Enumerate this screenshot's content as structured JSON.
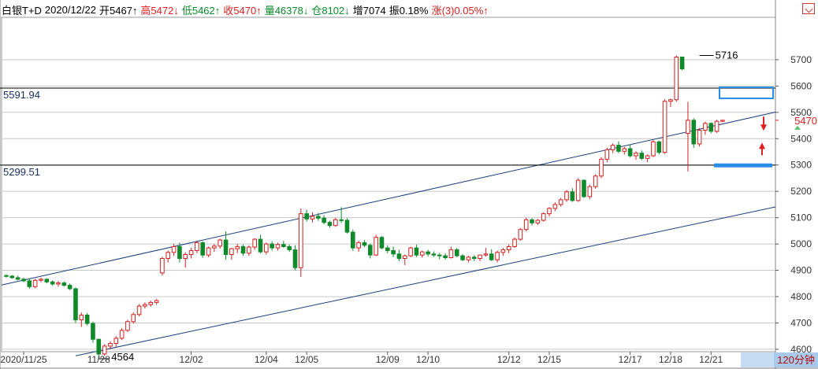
{
  "header": {
    "symbol": "白银T+D",
    "date": "2020/12/22",
    "open": "开5467↑",
    "high": "高5472↓",
    "low": "低5462↑",
    "close": "收5470↑",
    "volume": "量46378↓",
    "position": "仓8102↓",
    "increase": "增7074",
    "amplitude": "振0.18%",
    "change": "涨(3)0.05%↑"
  },
  "timeframe": "120分钟",
  "colors": {
    "up": "#d42020",
    "down": "#0e8a2a",
    "channel": "#1a3f7a",
    "highlight": "#2a8ee8",
    "grid": "#c8c8c8"
  },
  "chart_data": {
    "type": "candlestick",
    "ylim": [
      4575,
      5775
    ],
    "y_ticks": [
      4600,
      4700,
      4800,
      4900,
      5000,
      5100,
      5200,
      5300,
      5400,
      5500,
      5600,
      5700
    ],
    "x_labels": [
      {
        "label": "2020/11/25",
        "index": 3
      },
      {
        "label": "11/28",
        "index": 16
      },
      {
        "label": "12/02",
        "index": 32
      },
      {
        "label": "12/04",
        "index": 45
      },
      {
        "label": "12/05",
        "index": 52
      },
      {
        "label": "12/09",
        "index": 66
      },
      {
        "label": "12/10",
        "index": 73
      },
      {
        "label": "12/12",
        "index": 87
      },
      {
        "label": "12/15",
        "index": 94
      },
      {
        "label": "12/17",
        "index": 108
      },
      {
        "label": "12/18",
        "index": 115
      },
      {
        "label": "12/21",
        "index": 122
      }
    ],
    "candles": [
      [
        4880,
        4885,
        4872,
        4878
      ],
      [
        4878,
        4882,
        4868,
        4872
      ],
      [
        4872,
        4880,
        4862,
        4866
      ],
      [
        4866,
        4872,
        4855,
        4860
      ],
      [
        4860,
        4868,
        4830,
        4838
      ],
      [
        4838,
        4868,
        4832,
        4862
      ],
      [
        4862,
        4872,
        4855,
        4866
      ],
      [
        4866,
        4870,
        4850,
        4856
      ],
      [
        4856,
        4862,
        4842,
        4848
      ],
      [
        4848,
        4860,
        4838,
        4852
      ],
      [
        4852,
        4858,
        4838,
        4843
      ],
      [
        4843,
        4850,
        4825,
        4830
      ],
      [
        4830,
        4835,
        4700,
        4712
      ],
      [
        4712,
        4740,
        4685,
        4730
      ],
      [
        4730,
        4738,
        4690,
        4698
      ],
      [
        4698,
        4705,
        4625,
        4638
      ],
      [
        4638,
        4640,
        4564,
        4582
      ],
      [
        4582,
        4620,
        4575,
        4612
      ],
      [
        4612,
        4630,
        4600,
        4622
      ],
      [
        4622,
        4650,
        4610,
        4642
      ],
      [
        4642,
        4680,
        4635,
        4672
      ],
      [
        4672,
        4712,
        4665,
        4705
      ],
      [
        4705,
        4740,
        4698,
        4732
      ],
      [
        4732,
        4772,
        4725,
        4764
      ],
      [
        4764,
        4778,
        4755,
        4770
      ],
      [
        4770,
        4785,
        4762,
        4778
      ],
      [
        4778,
        4790,
        4770,
        4785
      ],
      [
        4890,
        4952,
        4880,
        4945
      ],
      [
        4945,
        4975,
        4930,
        4968
      ],
      [
        4968,
        5000,
        4955,
        4990
      ],
      [
        4990,
        5005,
        4930,
        4945
      ],
      [
        4945,
        4968,
        4910,
        4960
      ],
      [
        4960,
        4985,
        4945,
        4975
      ],
      [
        4975,
        5012,
        4965,
        5005
      ],
      [
        5005,
        5010,
        4948,
        4958
      ],
      [
        4958,
        4990,
        4950,
        4985
      ],
      [
        4985,
        5000,
        4970,
        4992
      ],
      [
        4992,
        5020,
        4982,
        5015
      ],
      [
        5015,
        5048,
        4940,
        4960
      ],
      [
        4960,
        4985,
        4940,
        4982
      ],
      [
        4982,
        5000,
        4965,
        4990
      ],
      [
        4990,
        4998,
        4955,
        4965
      ],
      [
        4965,
        4995,
        4955,
        4988
      ],
      [
        4988,
        5022,
        4978,
        5018
      ],
      [
        5018,
        5035,
        4965,
        4970
      ],
      [
        4970,
        5005,
        4960,
        5000
      ],
      [
        5000,
        5010,
        4975,
        4985
      ],
      [
        4985,
        5005,
        4975,
        4998
      ],
      [
        4998,
        5012,
        4985,
        4990
      ],
      [
        4990,
        4998,
        4970,
        4978
      ],
      [
        4978,
        4995,
        4900,
        4910
      ],
      [
        4910,
        5135,
        4875,
        5115
      ],
      [
        5115,
        5130,
        5085,
        5095
      ],
      [
        5095,
        5120,
        5082,
        5105
      ],
      [
        5105,
        5118,
        5088,
        5098
      ],
      [
        5098,
        5110,
        5075,
        5082
      ],
      [
        5082,
        5088,
        5062,
        5070
      ],
      [
        5070,
        5100,
        5065,
        5092
      ],
      [
        5092,
        5140,
        5080,
        5090
      ],
      [
        5090,
        5098,
        5040,
        5045
      ],
      [
        5045,
        5055,
        4975,
        4985
      ],
      [
        4985,
        5012,
        4970,
        5005
      ],
      [
        5005,
        5015,
        4988,
        4995
      ],
      [
        4995,
        5002,
        4945,
        4958
      ],
      [
        4958,
        5035,
        4955,
        5025
      ],
      [
        5025,
        5030,
        4980,
        4985
      ],
      [
        4985,
        4995,
        4965,
        4975
      ],
      [
        4975,
        4990,
        4950,
        4962
      ],
      [
        4962,
        4978,
        4935,
        4945
      ],
      [
        4945,
        4960,
        4920,
        4955
      ],
      [
        4955,
        4990,
        4950,
        4985
      ],
      [
        4985,
        4998,
        4950,
        4958
      ],
      [
        4958,
        4975,
        4948,
        4970
      ],
      [
        4970,
        4978,
        4952,
        4962
      ],
      [
        4962,
        4972,
        4950,
        4958
      ],
      [
        4958,
        4966,
        4942,
        4955
      ],
      [
        4955,
        4965,
        4940,
        4948
      ],
      [
        4948,
        4990,
        4945,
        4978
      ],
      [
        4978,
        4985,
        4950,
        4955
      ],
      [
        4955,
        4962,
        4935,
        4940
      ],
      [
        4940,
        4955,
        4930,
        4950
      ],
      [
        4950,
        4958,
        4935,
        4945
      ],
      [
        4945,
        4960,
        4935,
        4958
      ],
      [
        4958,
        4985,
        4952,
        4962
      ],
      [
        4962,
        4980,
        4935,
        4940
      ],
      [
        4940,
        4975,
        4930,
        4968
      ],
      [
        4968,
        4985,
        4955,
        4978
      ],
      [
        4978,
        4998,
        4965,
        4990
      ],
      [
        4990,
        5025,
        4985,
        5018
      ],
      [
        5018,
        5060,
        5012,
        5055
      ],
      [
        5055,
        5100,
        5048,
        5092
      ],
      [
        5092,
        5098,
        5070,
        5080
      ],
      [
        5080,
        5095,
        5072,
        5090
      ],
      [
        5090,
        5120,
        5085,
        5115
      ],
      [
        5115,
        5140,
        5105,
        5135
      ],
      [
        5135,
        5158,
        5125,
        5150
      ],
      [
        5150,
        5175,
        5142,
        5168
      ],
      [
        5168,
        5205,
        5160,
        5198
      ],
      [
        5198,
        5212,
        5160,
        5165
      ],
      [
        5165,
        5250,
        5160,
        5242
      ],
      [
        5242,
        5245,
        5175,
        5180
      ],
      [
        5180,
        5225,
        5170,
        5218
      ],
      [
        5218,
        5265,
        5210,
        5258
      ],
      [
        5258,
        5330,
        5250,
        5322
      ],
      [
        5322,
        5365,
        5310,
        5358
      ],
      [
        5358,
        5382,
        5345,
        5375
      ],
      [
        5375,
        5390,
        5345,
        5352
      ],
      [
        5352,
        5368,
        5340,
        5362
      ],
      [
        5362,
        5378,
        5328,
        5335
      ],
      [
        5335,
        5352,
        5320,
        5345
      ],
      [
        5345,
        5355,
        5318,
        5325
      ],
      [
        5325,
        5340,
        5310,
        5335
      ],
      [
        5335,
        5395,
        5330,
        5388
      ],
      [
        5388,
        5392,
        5340,
        5348
      ],
      [
        5348,
        5550,
        5342,
        5542
      ],
      [
        5542,
        5552,
        5520,
        5548
      ],
      [
        5548,
        5716,
        5540,
        5710
      ],
      [
        5710,
        5712,
        5660,
        5665
      ],
      [
        5420,
        5540,
        5275,
        5470
      ],
      [
        5470,
        5478,
        5365,
        5380
      ],
      [
        5380,
        5440,
        5370,
        5432
      ],
      [
        5432,
        5465,
        5415,
        5458
      ],
      [
        5458,
        5462,
        5420,
        5428
      ],
      [
        5428,
        5472,
        5422,
        5466
      ],
      [
        5466,
        5472,
        5462,
        5470
      ]
    ],
    "annotations": {
      "high_label": "5716",
      "low_label": "4564",
      "last_price": "5470",
      "level_1_value": 5591.94,
      "level_1_label": "5591.94",
      "level_2_value": 5299.51,
      "level_2_label": "5299.51"
    }
  }
}
